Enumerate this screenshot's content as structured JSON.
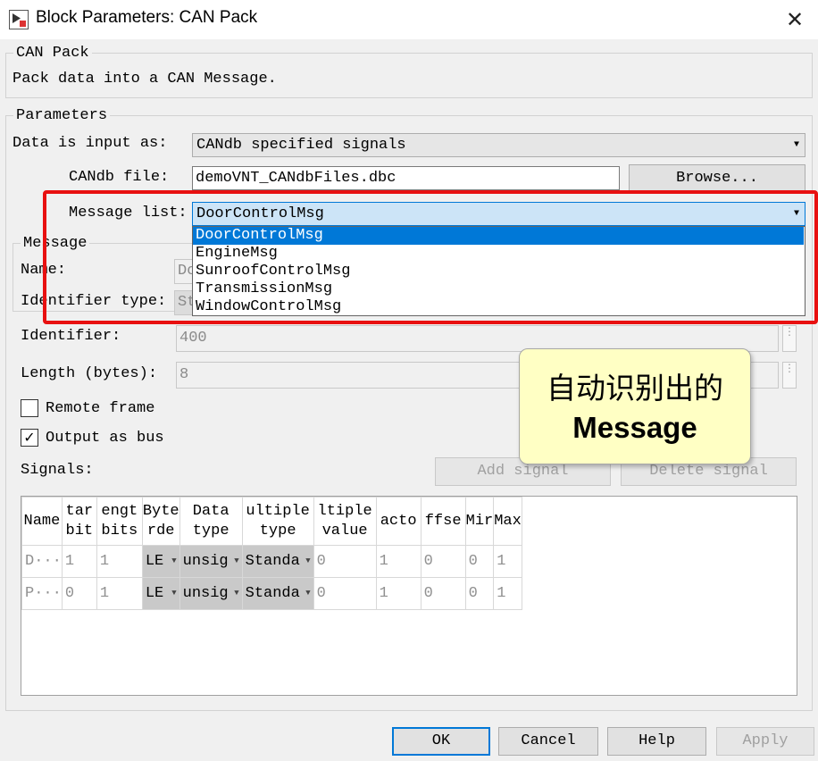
{
  "window": {
    "title": "Block Parameters: CAN Pack",
    "close_icon": "close-icon",
    "app_icon": "simulink-block-icon"
  },
  "block": {
    "legend": "CAN Pack",
    "description": "Pack data into a CAN Message."
  },
  "parameters": {
    "legend": "Parameters",
    "data_input_label": "Data is input as:",
    "data_input_value": "CANdb specified signals",
    "candb_file_label": "CANdb file:",
    "candb_file_value": "demoVNT_CANdbFiles.dbc",
    "browse_label": "Browse...",
    "message_list_label": "Message list:",
    "message_list_value": "DoorControlMsg",
    "message_list_options": [
      "DoorControlMsg",
      "EngineMsg",
      "SunroofControlMsg",
      "TransmissionMsg",
      "WindowControlMsg"
    ]
  },
  "message": {
    "legend": "Message",
    "name_label": "Name:",
    "name_value": "Do",
    "identifier_type_label": "Identifier type:",
    "identifier_type_value": "St",
    "identifier_label": "Identifier:",
    "identifier_value": "400",
    "length_label": "Length (bytes):",
    "length_value": "8",
    "remote_frame_label": "Remote frame",
    "remote_frame_checked": false,
    "output_as_bus_label": "Output as bus",
    "output_as_bus_checked": true,
    "check_mark": "✓"
  },
  "signals": {
    "label": "Signals:",
    "add_signal_label": "Add signal",
    "delete_signal_label": "Delete signal",
    "columns": [
      [
        "Name",
        ""
      ],
      [
        "tar",
        "bit"
      ],
      [
        "engt",
        "bits"
      ],
      [
        "Byte",
        "rde"
      ],
      [
        "Data",
        "type"
      ],
      [
        "ultiple",
        "type"
      ],
      [
        "ltiple",
        "value"
      ],
      [
        "acto",
        ""
      ],
      [
        "ffse",
        ""
      ],
      [
        "Mir",
        ""
      ],
      [
        "Max",
        ""
      ]
    ],
    "rows": [
      [
        "D···",
        "1",
        "1",
        "LE",
        "unsig",
        "Standa",
        "0",
        "1",
        "0",
        "0",
        "1"
      ],
      [
        "P···",
        "0",
        "1",
        "LE",
        "unsig",
        "Standa",
        "0",
        "1",
        "0",
        "0",
        "1"
      ]
    ]
  },
  "callout": {
    "line1": "自动识别出的",
    "line2": "Message"
  },
  "footer": {
    "ok_label": "OK",
    "cancel_label": "Cancel",
    "help_label": "Help",
    "apply_label": "Apply"
  },
  "colors": {
    "highlight_red": "#e81010",
    "selection_blue": "#0078d7",
    "callout_bg": "#ffffc4"
  }
}
